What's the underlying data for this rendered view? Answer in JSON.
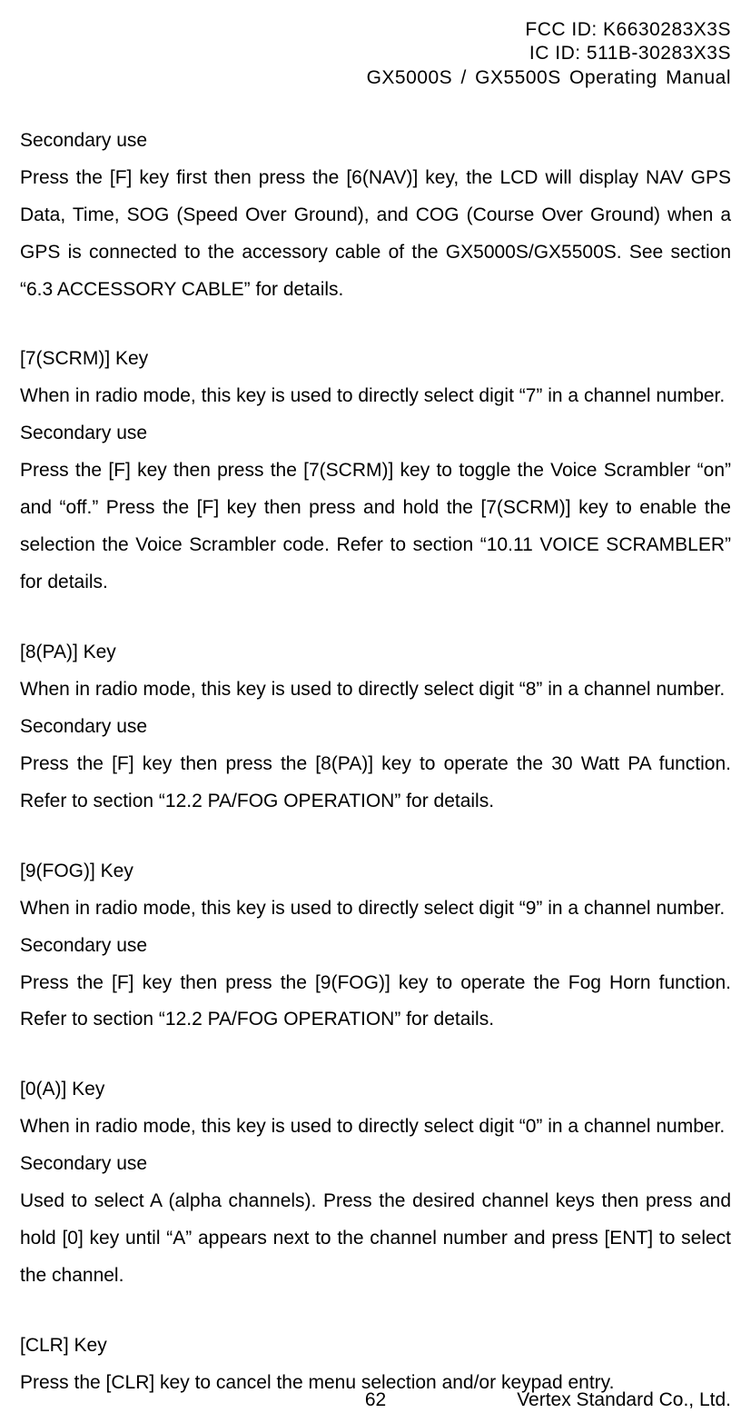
{
  "header": {
    "fcc": "FCC ID: K6630283X3S",
    "ic": "IC ID: 511B-30283X3S",
    "model": "GX5000S / GX5500S  Operating Manual"
  },
  "sections": [
    {
      "heading": "Secondary use",
      "body": "Press the [F] key first then press the [6(NAV)] key, the LCD will display NAV GPS Data, Time, SOG (Speed Over Ground), and COG (Course Over Ground) when a GPS is connected to the accessory cable of the GX5000S/GX5500S. See section “6.3 ACCESSORY CABLE” for details."
    },
    {
      "heading": "[7(SCRM)] Key",
      "line1": "When in radio mode, this key is used to directly select digit “7” in a channel number.",
      "sub": "Secondary use",
      "body": "Press the [F] key then press the [7(SCRM)] key to toggle the Voice Scrambler “on” and “off.” Press the [F] key then press and hold the [7(SCRM)] key to enable the selection the Voice Scrambler code. Refer to section “10.11 VOICE SCRAMBLER” for details."
    },
    {
      "heading": "[8(PA)] Key",
      "line1": "When in radio mode, this key is used to directly select digit “8” in a channel number.",
      "sub": "Secondary use",
      "body": "Press the [F] key then press the [8(PA)] key to operate the 30 Watt PA function. Refer to section “12.2 PA/FOG OPERATION” for details."
    },
    {
      "heading": "[9(FOG)] Key",
      "line1": "When in radio mode, this key is used to directly select digit “9” in a channel number.",
      "sub": "Secondary use",
      "body": "Press the [F] key then press the [9(FOG)] key to operate the Fog Horn function. Refer to section “12.2 PA/FOG OPERATION” for details."
    },
    {
      "heading": "[0(A)] Key",
      "line1": "When in radio mode, this key is used to directly select digit “0” in a channel number.",
      "sub": "Secondary use",
      "body": "Used to select A (alpha channels). Press the desired channel keys then press and hold [0] key until “A” appears next to the channel number and press [ENT] to select the channel."
    },
    {
      "heading": "[CLR] Key",
      "line1": "Press the [CLR] key to cancel the menu selection and/or keypad entry."
    }
  ],
  "footer": {
    "page": "62",
    "company": "Vertex Standard Co., Ltd."
  }
}
